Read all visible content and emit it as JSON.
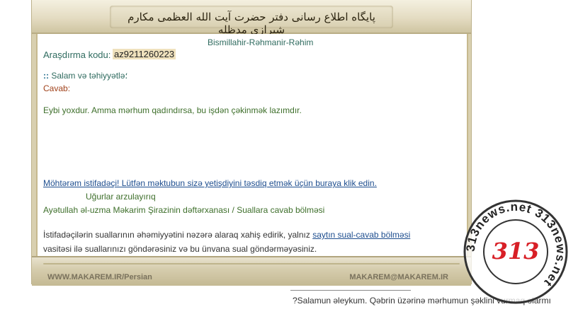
{
  "header": {
    "site_title": "پایگاه اطلاع رسانی دفتر حضرت آیت الله العظمی مکارم شیرازی مدظله"
  },
  "content": {
    "bismillah": "Bismillahir-Rəhmanir-Rəhim",
    "code_label": "Araşdırma kodu:",
    "code_value": "az9211260223",
    "greeting_marker": "::",
    "greeting": "Salam və təhiyyətlə؛",
    "answer_label": "Cavab:",
    "answer_text": "Eybi yoxdur. Amma mərhum qadındırsa, bu işdən çəkinmək lazımdır.",
    "confirm_link": "Möhtərəm istifadəçi! Lütfən məktubun sizə yetişdiyini təsdiq etmək üçün buraya klik edin.",
    "wishes": "Uğurlar arzulayırıq",
    "office": "Ayətullah əl-uzma Məkarim Şirazinin dəftərxanası / Suallara cavab bölməsi",
    "notice_line1_before": "İstifadəçilərin suallarının əhəmiyyətini nəzərə alaraq xahiş edirik, yalnız ",
    "notice_link": "saytın sual-cavab bölməsi",
    "notice_line2": "vasitəsi ilə suallarınızı göndərəsiniz və bu ünvana sual göndərməyəsiniz."
  },
  "footer": {
    "left_text": "WWW.MAKAREM.IR/Persian",
    "right_text": "MAKAREM@MAKAREM.IR"
  },
  "below": {
    "question": "?Salamun əleykum. Qəbrin üzərinə mərhumun şəklini vurmaq olarmı"
  },
  "watermark": {
    "number": "313",
    "ring_text": "313news.net 313news.net",
    "accent_color": "#d81f26"
  }
}
